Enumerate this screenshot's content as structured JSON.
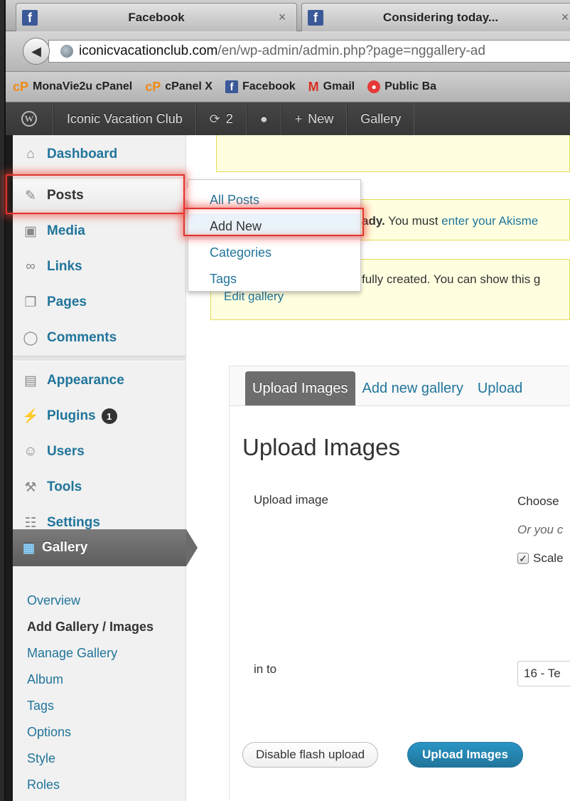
{
  "browser": {
    "tabs": [
      {
        "label": "Facebook",
        "close": "×"
      },
      {
        "label": "Considering today...",
        "close": "×"
      }
    ],
    "url": {
      "domain": "iconicvacationclub.com",
      "path": "/en/wp-admin/admin.php?page=nggallery-ad"
    },
    "bookmarks": [
      {
        "icon": "cpanel-icon",
        "icon_text": "cP",
        "label": "MonaVie2u cPanel"
      },
      {
        "icon": "cpanel-icon",
        "icon_text": "cP",
        "label": "cPanel X"
      },
      {
        "icon": "facebook-icon",
        "icon_text": "f",
        "label": "Facebook"
      },
      {
        "icon": "gmail-icon",
        "icon_text": "M",
        "label": "Gmail"
      },
      {
        "icon": "public-bank-icon",
        "icon_text": "",
        "label": "Public Ba"
      }
    ]
  },
  "adminbar": {
    "site_name": "Iconic Vacation Club",
    "updates_count": "2",
    "new_label": "New",
    "gallery_label": "Gallery"
  },
  "sidebar": {
    "items": [
      {
        "label": "Dashboard",
        "icon": "home-icon"
      },
      {
        "label": "Posts",
        "icon": "pushpin-icon"
      },
      {
        "label": "Media",
        "icon": "media-icon"
      },
      {
        "label": "Links",
        "icon": "link-icon"
      },
      {
        "label": "Pages",
        "icon": "pages-icon"
      },
      {
        "label": "Comments",
        "icon": "comment-icon"
      },
      {
        "label": "Appearance",
        "icon": "appearance-icon"
      },
      {
        "label": "Plugins",
        "icon": "plugin-icon",
        "badge": "1"
      },
      {
        "label": "Users",
        "icon": "users-icon"
      },
      {
        "label": "Tools",
        "icon": "tools-icon"
      },
      {
        "label": "Settings",
        "icon": "settings-icon"
      }
    ],
    "gallery": {
      "label": "Gallery",
      "submenu": [
        "Overview",
        "Add Gallery / Images",
        "Manage Gallery",
        "Album",
        "Tags",
        "Options",
        "Style",
        "Roles"
      ]
    }
  },
  "posts_flyout": {
    "items": [
      "All Posts",
      "Add New",
      "Categories",
      "Tags"
    ]
  },
  "notices": {
    "akismet_bold": "ady.",
    "akismet_text": " You must ",
    "akismet_link": "enter your Akisme",
    "gallery_text": "fully created. You can show this g",
    "gallery_link": "Edit gallery"
  },
  "upload": {
    "tabs": [
      "Upload Images",
      "Add new gallery",
      "Upload"
    ],
    "title": "Upload Images",
    "upload_image_label": "Upload image",
    "choose_text": "Choose",
    "or_text": "Or you c",
    "scale_label": "Scale",
    "into_label": "in to",
    "gallery_select": "16 - Te",
    "disable_flash_label": "Disable flash upload",
    "upload_button_label": "Upload Images"
  },
  "colors": {
    "link": "#21759b",
    "highlight": "#e0332e",
    "notice_bg": "#ffffe0",
    "adminbar_bg": "#464646"
  }
}
